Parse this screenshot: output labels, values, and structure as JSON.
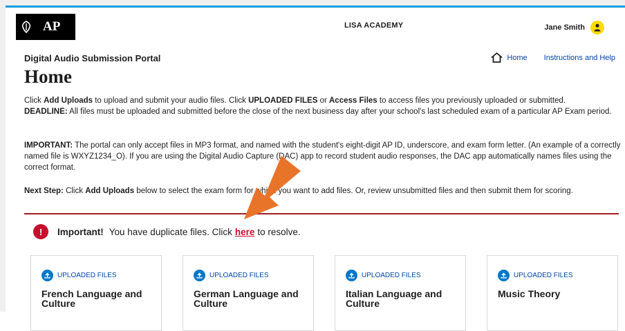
{
  "header": {
    "logo_text": "AP",
    "school": "LISA ACADEMY",
    "user_name": "Jane Smith"
  },
  "portal_title": "Digital Audio Submission Portal",
  "nav": {
    "home": "Home",
    "help": "Instructions and Help"
  },
  "page_title": "Home",
  "p1": {
    "t1": "Click ",
    "b1": "Add Uploads",
    "t2": " to upload and submit your audio files. Click ",
    "b2": "UPLOADED FILES",
    "t3": " or ",
    "b3": "Access Files",
    "t4": " to access files you previously uploaded or submitted.",
    "b4": "DEADLINE:",
    "t5": " All files must be uploaded and submitted before the close of the next business day after your school's last scheduled exam of a particular AP Exam period."
  },
  "p2": {
    "b1": "IMPORTANT:",
    "t1": " The portal can only accept files in MP3 format, and named with the student's eight-digit AP ID, underscore, and exam form letter. (An example of a correctly named file is WXYZ1234_O). If you are using the Digital Audio Capture (DAC) app to record student audio responses, the DAC app automatically names files using the correct format."
  },
  "p3": {
    "b1": "Next Step:",
    "t1": " Click ",
    "b2": "Add Uploads",
    "t2": " below to select the exam form for which you want to add files. Or, review unsubmitted files and then submit them for scoring."
  },
  "alert": {
    "icon": "!",
    "bold": "Important!",
    "before": "You have duplicate files. Click",
    "link": "here",
    "after": "to resolve."
  },
  "cards": [
    {
      "upload_label": "UPLOADED FILES",
      "title": "French Language and Culture"
    },
    {
      "upload_label": "UPLOADED FILES",
      "title": "German Language and Culture"
    },
    {
      "upload_label": "UPLOADED FILES",
      "title": "Italian Language and Culture"
    },
    {
      "upload_label": "UPLOADED FILES",
      "title": "Music Theory"
    }
  ],
  "colors": {
    "accent_blue": "#009cde",
    "link_blue": "#0045a5",
    "alert_red": "#c8102e",
    "divider_red": "#a01c21",
    "avatar_yellow": "#fedb00",
    "arrow_orange": "#e8742a"
  }
}
